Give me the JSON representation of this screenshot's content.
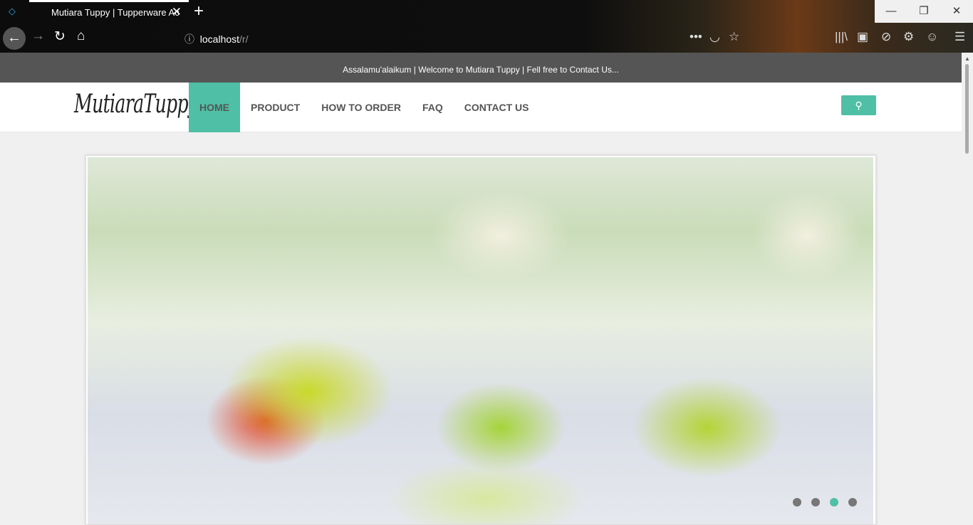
{
  "browser": {
    "tab_title": "Mutiara Tuppy | Tupperware Ac",
    "url_host": "localhost",
    "url_path": "/r/"
  },
  "topbar": {
    "text": "Assalamu'alaikum | Welcome to Mutiara Tuppy | Fell free to Contact Us..."
  },
  "header": {
    "logo": "MutiaraTuppy",
    "nav": [
      {
        "label": "HOME",
        "active": true
      },
      {
        "label": "PRODUCT"
      },
      {
        "label": "HOW TO ORDER"
      },
      {
        "label": "FAQ"
      },
      {
        "label": "CONTACT US"
      }
    ],
    "search_icon": "search-icon"
  },
  "slider": {
    "slides": 4,
    "active_index": 2,
    "accent": "#4fbfa6"
  }
}
